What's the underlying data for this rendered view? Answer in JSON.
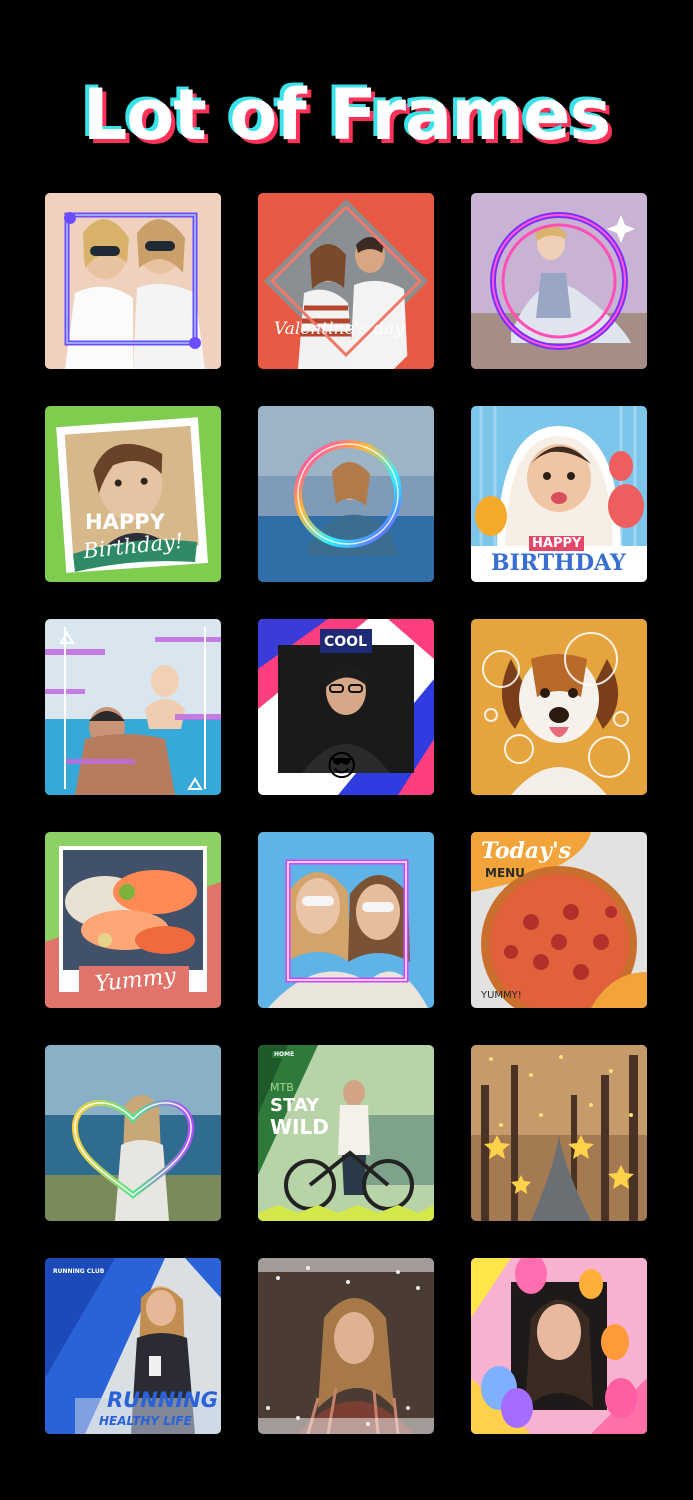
{
  "header": {
    "title": "Lot of Frames"
  },
  "frames": [
    {
      "name": "square-neon-frame",
      "caption": ""
    },
    {
      "name": "valentine-frame",
      "caption": "Valentine's day"
    },
    {
      "name": "ring-glow-frame",
      "caption": ""
    },
    {
      "name": "happy-birthday-green-frame",
      "caption_line1": "HAPPY",
      "caption_line2": "Birthday!"
    },
    {
      "name": "neon-circle-frame",
      "caption": ""
    },
    {
      "name": "happy-birthday-balloons-frame",
      "caption_line1": "HAPPY",
      "caption_line2": "BIRTHDAY"
    },
    {
      "name": "glitch-pool-frame",
      "caption": ""
    },
    {
      "name": "cool-frame",
      "caption": "COOL",
      "emoji": "😎"
    },
    {
      "name": "bubbles-frame",
      "caption": ""
    },
    {
      "name": "yummy-frame",
      "caption": "Yummy"
    },
    {
      "name": "neon-square-friends-frame",
      "caption": ""
    },
    {
      "name": "todays-menu-frame",
      "caption_line1": "Today's",
      "caption_line2": "MENU",
      "caption_line3": "YUMMY!"
    },
    {
      "name": "heart-neon-frame",
      "caption": ""
    },
    {
      "name": "stay-wild-frame",
      "caption_small": "HOME",
      "caption_line0": "MTB",
      "caption_line1": "STAY",
      "caption_line2": "WILD"
    },
    {
      "name": "stars-forest-frame",
      "caption": ""
    },
    {
      "name": "running-frame",
      "caption_small": "RUNNING CLUB",
      "caption_line1": "RUNNING",
      "caption_line2": "HEALTHY LIFE"
    },
    {
      "name": "glitter-frame",
      "caption": ""
    },
    {
      "name": "party-balloons-frame",
      "caption": ""
    }
  ]
}
